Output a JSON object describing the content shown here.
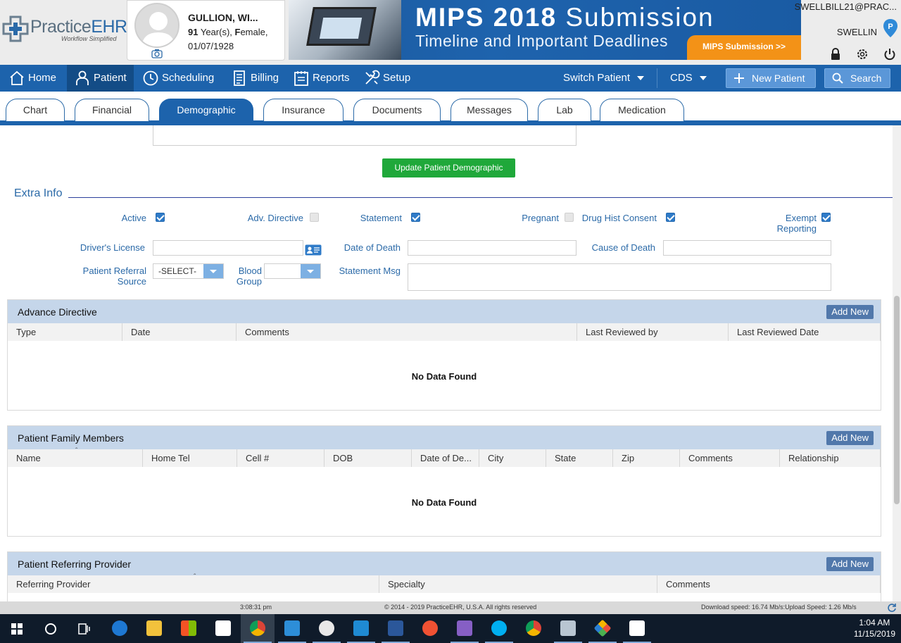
{
  "app": {
    "brand_name": "PracticeEHR",
    "brand_tagline": "Workflow Simplified"
  },
  "patient": {
    "name": "GULLION, WI...",
    "age_number": "91",
    "age_text": " Year(s), ",
    "gender_initial": "F",
    "gender_rest": "emale,",
    "dob": "01/07/1928"
  },
  "banner": {
    "title_bold": "MIPS 2018",
    "title_light": " Submission",
    "subtitle": "Timeline and Important Deadlines",
    "cta": "MIPS Submission >>"
  },
  "user": {
    "email": "SWELLBILL21@PRAC...",
    "username": "SWELLIN"
  },
  "nav": {
    "items": [
      {
        "label": "Home"
      },
      {
        "label": "Patient"
      },
      {
        "label": "Scheduling"
      },
      {
        "label": "Billing"
      },
      {
        "label": "Reports"
      },
      {
        "label": "Setup"
      }
    ],
    "switch_patient": "Switch Patient",
    "cds": "CDS",
    "new_patient": "New Patient",
    "search": "Search"
  },
  "tabs": [
    "Chart",
    "Financial",
    "Demographic",
    "Insurance",
    "Documents",
    "Messages",
    "Lab",
    "Medication"
  ],
  "active_tab": "Demographic",
  "demographic": {
    "update_button": "Update Patient Demographic",
    "section_title": "Extra Info"
  },
  "extra_info": {
    "active_label": "Active",
    "active_checked": true,
    "adv_directive_label": "Adv. Directive",
    "adv_directive_checked": false,
    "statement_label": "Statement",
    "statement_checked": true,
    "pregnant_label": "Pregnant",
    "pregnant_checked": false,
    "drug_hist_label": "Drug Hist Consent",
    "drug_hist_checked": true,
    "exempt_label_1": "Exempt",
    "exempt_label_2": "Reporting",
    "exempt_checked": true,
    "drivers_license_label": "Driver's License",
    "drivers_license_value": "",
    "date_of_death_label": "Date of Death",
    "date_of_death_value": "",
    "cause_of_death_label": "Cause of Death",
    "cause_of_death_value": "",
    "referral_label_1": "Patient Referral",
    "referral_label_2": "Source",
    "referral_value": "-SELECT-",
    "blood_label_1": "Blood",
    "blood_label_2": "Group",
    "blood_value": "",
    "statement_msg_label": "Statement Msg",
    "statement_msg_value": ""
  },
  "advance_directive": {
    "title": "Advance Directive",
    "add_label": "Add New",
    "columns": [
      "Type",
      "Date",
      "Comments",
      "Last Reviewed by",
      "Last Reviewed Date"
    ],
    "empty_text": "No Data Found"
  },
  "family_members": {
    "title": "Patient Family Members",
    "add_label": "Add New",
    "columns": [
      "Name",
      "Home Tel",
      "Cell #",
      "DOB",
      "Date of De...",
      "City",
      "State",
      "Zip",
      "Comments",
      "Relationship"
    ],
    "empty_text": "No Data Found"
  },
  "referring_provider": {
    "title": "Patient Referring Provider",
    "add_label": "Add New",
    "columns": [
      "Referring Provider",
      "Specialty",
      "Comments"
    ]
  },
  "footer": {
    "time": "3:08:31 pm",
    "copyright": "© 2014 - 2019 PracticeEHR, U.S.A. All rights reserved",
    "speed": "Download speed: 16.74 Mb/s:Upload Speed: 1.26 Mb/s"
  },
  "taskbar": {
    "time": "1:04 AM",
    "date": "11/15/2019",
    "apps": [
      "start-icon",
      "cortana-icon",
      "task-view-icon",
      "edge-icon",
      "file-explorer-icon",
      "store-icon",
      "mail-icon",
      "chrome-icon",
      "remote-desktop-icon",
      "paint-icon",
      "vscode-icon",
      "word-icon",
      "git-gui-icon",
      "visual-studio-icon",
      "skype-icon",
      "chrome-icon-2",
      "network-icon",
      "sourcetree-icon",
      "photos-icon"
    ]
  },
  "colors": {
    "nav_blue": "#1d63ac",
    "nav_active": "#134c86",
    "update_green": "#1fa83a",
    "banner_orange": "#f39217",
    "panel_header": "#c5d6ea"
  }
}
